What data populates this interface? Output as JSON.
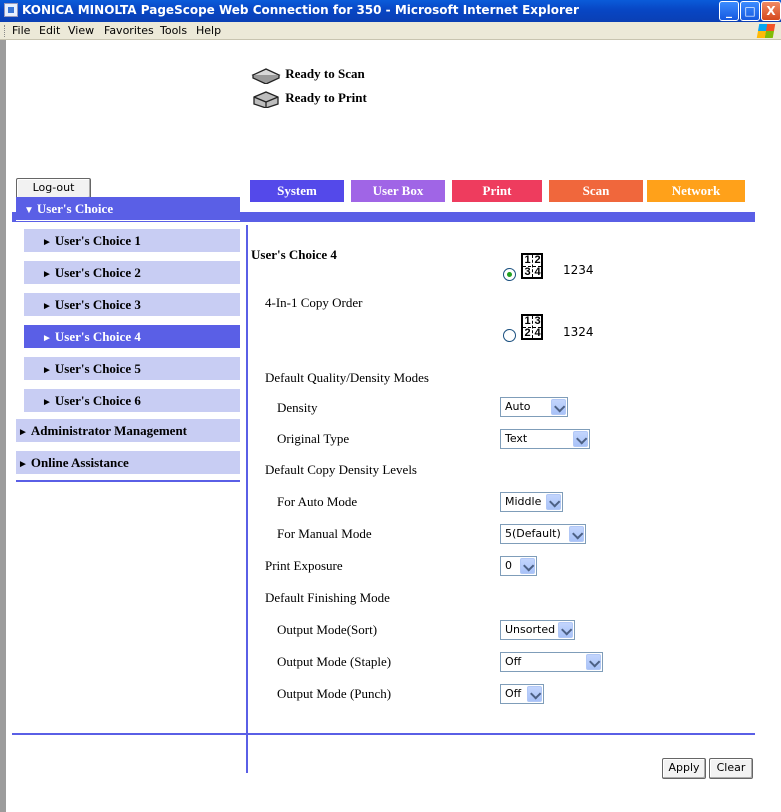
{
  "window": {
    "title": "KONICA MINOLTA PageScope Web Connection for 350 - Microsoft Internet Explorer",
    "controls": {
      "minimize": "_",
      "maximize": "□",
      "close": "X"
    }
  },
  "menubar": [
    "File",
    "Edit",
    "View",
    "Favorites",
    "Tools",
    "Help"
  ],
  "status": {
    "scan": "Ready to Scan",
    "print": "Ready to Print"
  },
  "logout_label": "Log-out",
  "tabs": [
    "System",
    "User Box",
    "Print",
    "Scan",
    "Network"
  ],
  "sidebar": {
    "main": "User's Choice",
    "items": [
      "User's Choice 1",
      "User's Choice 2",
      "User's Choice 3",
      "User's Choice 4",
      "User's Choice 5",
      "User's Choice 6"
    ],
    "active_item": "User's Choice 4",
    "admin": "Administrator Management",
    "online": "Online Assistance"
  },
  "content": {
    "section_title": "User's Choice 4",
    "copy_order": {
      "label": "4-In-1 Copy Order",
      "options": [
        {
          "text": "1234",
          "grid": [
            "1",
            "2",
            "3",
            "4"
          ],
          "checked": true
        },
        {
          "text": "1324",
          "grid": [
            "1",
            "3",
            "2",
            "4"
          ],
          "checked": false
        }
      ]
    },
    "quality_header": "Default Quality/Density Modes",
    "density": {
      "label": "Density",
      "value": "Auto"
    },
    "original_type": {
      "label": "Original Type",
      "value": "Text"
    },
    "density_levels_header": "Default Copy Density Levels",
    "auto_mode": {
      "label": "For Auto Mode",
      "value": "Middle"
    },
    "manual_mode": {
      "label": "For Manual Mode",
      "value": "5(Default)"
    },
    "print_exposure": {
      "label": "Print Exposure",
      "value": "0"
    },
    "finishing_header": "Default Finishing Mode",
    "output_sort": {
      "label": "Output Mode(Sort)",
      "value": "Unsorted"
    },
    "output_staple": {
      "label": "Output Mode (Staple)",
      "value": "Off"
    },
    "output_punch": {
      "label": "Output Mode (Punch)",
      "value": "Off"
    }
  },
  "buttons": {
    "apply": "Apply",
    "clear": "Clear"
  },
  "colors": {
    "sidebar_main": "#5a5fe6",
    "sidebar_sub": "#c8cdf3",
    "tab_system": "#5449ea",
    "tab_userbox": "#a065e6",
    "tab_print": "#ee3c5e",
    "tab_scan": "#f0673c",
    "tab_network": "#ffa11a"
  }
}
